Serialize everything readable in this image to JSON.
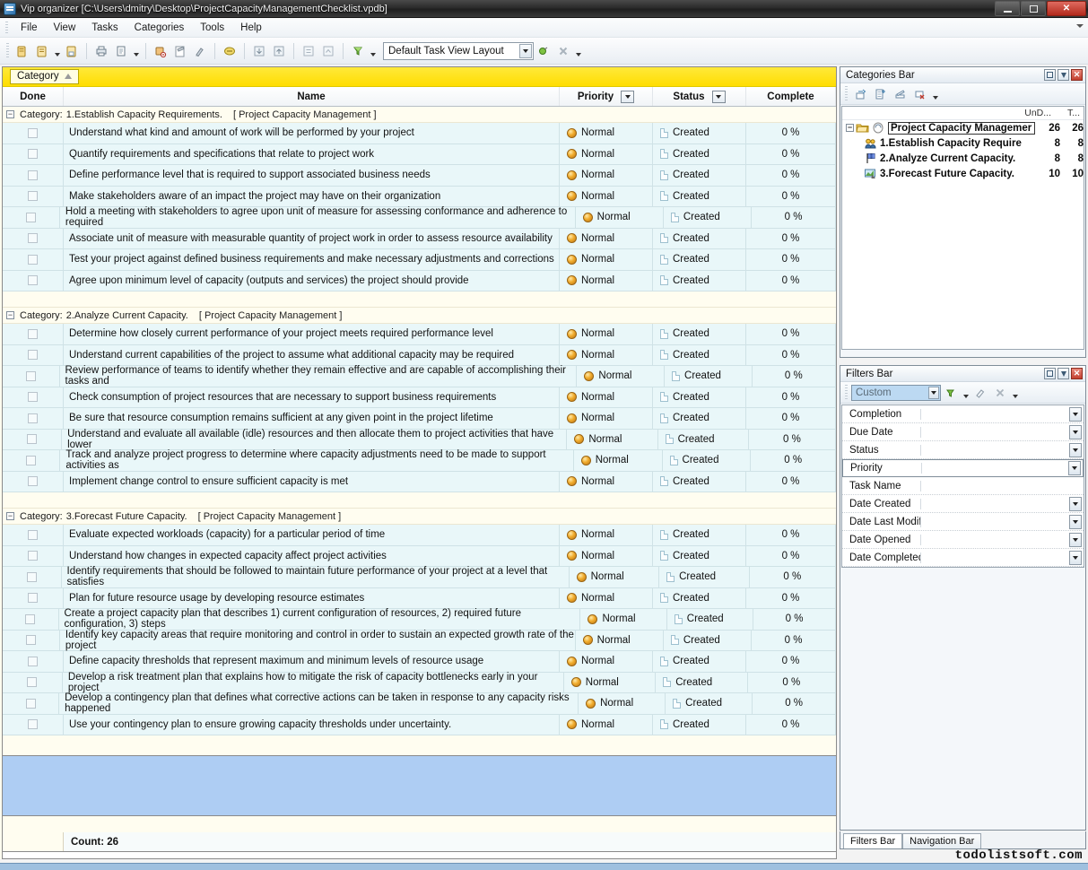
{
  "window": {
    "title": "Vip organizer [C:\\Users\\dmitry\\Desktop\\ProjectCapacityManagementChecklist.vpdb]",
    "app_icon": "app-icon",
    "minimize": "minimize-icon",
    "maximize": "maximize-icon",
    "close": "close-icon"
  },
  "menu": {
    "items": [
      "File",
      "View",
      "Tasks",
      "Categories",
      "Tools",
      "Help"
    ]
  },
  "toolbar": {
    "layout_value": "Default Task View Layout",
    "icons": [
      "new-task-icon",
      "open-icon",
      "open-dropdown-icon",
      "save-icon",
      "print-icon",
      "print-preview-icon",
      "print-dropdown-icon",
      "new-category-icon",
      "edit-task-icon",
      "properties-icon",
      "complete-icon",
      "move-down-icon",
      "move-up-icon",
      "indent-icon",
      "outdent-icon",
      "filter-icon",
      "filter-dropdown-icon",
      "apply-layout-icon",
      "delete-layout-icon",
      "toolbar-overflow-icon"
    ]
  },
  "grid": {
    "group_chip": "Category",
    "group_sort": "ascending",
    "columns": [
      "Done",
      "Name",
      "Priority",
      "Status",
      "Complete"
    ],
    "groups": [
      {
        "header_prefix": "Category:",
        "header_name": "1.Establish Capacity Requirements.",
        "header_project": "[ Project Capacity Management  ]",
        "tasks": [
          {
            "name": "Understand what kind and amount of work will be performed by your project",
            "priority": "Normal",
            "status": "Created",
            "complete": "0 %"
          },
          {
            "name": "Quantify requirements and specifications that relate to project work",
            "priority": "Normal",
            "status": "Created",
            "complete": "0 %"
          },
          {
            "name": "Define performance level that is required to support associated business needs",
            "priority": "Normal",
            "status": "Created",
            "complete": "0 %"
          },
          {
            "name": "Make stakeholders aware of an impact the project may have on their organization",
            "priority": "Normal",
            "status": "Created",
            "complete": "0 %"
          },
          {
            "name": "Hold a meeting with stakeholders to agree upon unit of measure for assessing conformance and adherence to required",
            "priority": "Normal",
            "status": "Created",
            "complete": "0 %"
          },
          {
            "name": "Associate unit of measure with measurable quantity of project work in order to assess resource availability",
            "priority": "Normal",
            "status": "Created",
            "complete": "0 %"
          },
          {
            "name": "Test your project against defined business requirements and make necessary adjustments and corrections",
            "priority": "Normal",
            "status": "Created",
            "complete": "0 %"
          },
          {
            "name": "Agree upon minimum level of capacity (outputs and services) the project should provide",
            "priority": "Normal",
            "status": "Created",
            "complete": "0 %"
          }
        ]
      },
      {
        "header_prefix": "Category:",
        "header_name": "2.Analyze Current Capacity.",
        "header_project": "[ Project Capacity Management  ]",
        "tasks": [
          {
            "name": "Determine how closely current performance of your project meets required performance level",
            "priority": "Normal",
            "status": "Created",
            "complete": "0 %"
          },
          {
            "name": "Understand current capabilities of the project to assume what additional capacity may be required",
            "priority": "Normal",
            "status": "Created",
            "complete": "0 %"
          },
          {
            "name": "Review performance of teams to identify whether they remain effective and are capable of accomplishing their tasks and",
            "priority": "Normal",
            "status": "Created",
            "complete": "0 %"
          },
          {
            "name": "Check consumption of project resources that are necessary to support business requirements",
            "priority": "Normal",
            "status": "Created",
            "complete": "0 %"
          },
          {
            "name": "Be sure that resource consumption remains sufficient at any given point in the project lifetime",
            "priority": "Normal",
            "status": "Created",
            "complete": "0 %"
          },
          {
            "name": "Understand and evaluate all available (idle) resources and then allocate them to project activities that have lower",
            "priority": "Normal",
            "status": "Created",
            "complete": "0 %"
          },
          {
            "name": "Track and analyze project progress to determine where capacity adjustments need to be made to support activities as",
            "priority": "Normal",
            "status": "Created",
            "complete": "0 %"
          },
          {
            "name": "Implement change control to ensure sufficient capacity is met",
            "priority": "Normal",
            "status": "Created",
            "complete": "0 %"
          }
        ]
      },
      {
        "header_prefix": "Category:",
        "header_name": "3.Forecast Future Capacity.",
        "header_project": "[ Project Capacity Management  ]",
        "tasks": [
          {
            "name": "Evaluate expected workloads (capacity) for a particular period of time",
            "priority": "Normal",
            "status": "Created",
            "complete": "0 %"
          },
          {
            "name": "Understand how changes in expected capacity affect project activities",
            "priority": "Normal",
            "status": "Created",
            "complete": "0 %"
          },
          {
            "name": "Identify requirements that should be followed to maintain future performance of your project at a level that satisfies",
            "priority": "Normal",
            "status": "Created",
            "complete": "0 %"
          },
          {
            "name": "Plan for future resource usage by developing resource estimates",
            "priority": "Normal",
            "status": "Created",
            "complete": "0 %"
          },
          {
            "name": "Create a project capacity plan that describes 1) current configuration of resources, 2) required future configuration, 3) steps",
            "priority": "Normal",
            "status": "Created",
            "complete": "0 %"
          },
          {
            "name": "Identify key capacity areas that require monitoring and control in order to sustain an expected growth rate of the project",
            "priority": "Normal",
            "status": "Created",
            "complete": "0 %"
          },
          {
            "name": "Define capacity thresholds that represent maximum and minimum levels of resource usage",
            "priority": "Normal",
            "status": "Created",
            "complete": "0 %"
          },
          {
            "name": "Develop a risk treatment plan that explains how to mitigate the risk of capacity bottlenecks early in your project",
            "priority": "Normal",
            "status": "Created",
            "complete": "0 %"
          },
          {
            "name": "Develop a contingency plan that defines what  corrective actions can be taken in response to any capacity risks happened",
            "priority": "Normal",
            "status": "Created",
            "complete": "0 %"
          },
          {
            "name": "Use your contingency plan to ensure growing capacity thresholds under uncertainty.",
            "priority": "Normal",
            "status": "Created",
            "complete": "0 %"
          }
        ]
      }
    ],
    "status_count": "Count: 26"
  },
  "categories_panel": {
    "title": "Categories Bar",
    "toolbar_icons": [
      "add-category-icon",
      "add-subcategory-icon",
      "edit-category-icon",
      "delete-category-icon",
      "categories-overflow-icon"
    ],
    "col_undone": "UnD...",
    "col_total": "T...",
    "tree": [
      {
        "label": "Project Capacity Managemer",
        "undone": "26",
        "total": "26",
        "level": 0,
        "icon": "project-icon"
      },
      {
        "label": "1.Establish Capacity Require",
        "undone": "8",
        "total": "8",
        "level": 1,
        "icon": "people-icon"
      },
      {
        "label": "2.Analyze Current Capacity.",
        "undone": "8",
        "total": "8",
        "level": 1,
        "icon": "flag-icon"
      },
      {
        "label": "3.Forecast Future Capacity.",
        "undone": "10",
        "total": "10",
        "level": 1,
        "icon": "chart-icon"
      }
    ]
  },
  "filters_panel": {
    "title": "Filters Bar",
    "combo_value": "Custom",
    "toolbar_icons": [
      "apply-filter-icon",
      "filter-dropdown-icon",
      "clear-filter-icon",
      "delete-filter-icon",
      "filters-overflow-icon"
    ],
    "rows": [
      {
        "label": "Completion",
        "value": "",
        "has_button": true,
        "selected": false
      },
      {
        "label": "Due Date",
        "value": "",
        "has_button": true,
        "selected": false
      },
      {
        "label": "Status",
        "value": "",
        "has_button": true,
        "selected": false
      },
      {
        "label": "Priority",
        "value": "",
        "has_button": true,
        "selected": true
      },
      {
        "label": "Task Name",
        "value": "",
        "has_button": false,
        "selected": false
      },
      {
        "label": "Date Created",
        "value": "",
        "has_button": true,
        "selected": false
      },
      {
        "label": "Date Last Modifi",
        "value": "",
        "has_button": true,
        "selected": false
      },
      {
        "label": "Date Opened",
        "value": "",
        "has_button": true,
        "selected": false
      },
      {
        "label": "Date Completed",
        "value": "",
        "has_button": true,
        "selected": false
      }
    ]
  },
  "dock_tabs": [
    {
      "label": "Filters Bar",
      "active": true
    },
    {
      "label": "Navigation Bar",
      "active": false
    }
  ],
  "watermark": "todolistsoft.com",
  "colors": {
    "group_band": "#ffdd00",
    "row_bg": "#e9f7f9",
    "category_bg": "#fffdf0",
    "selection": "#aecdf3",
    "priority": "#f0ab2b"
  }
}
